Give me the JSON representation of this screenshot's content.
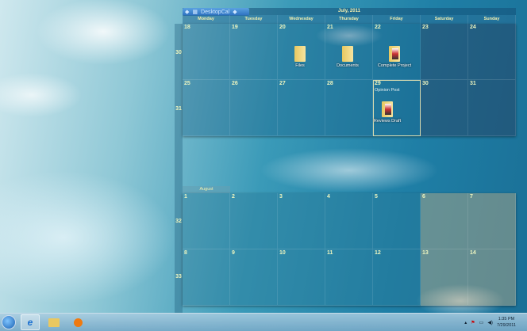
{
  "calendar": {
    "app_name": "DesktopCal",
    "month_title": "July, 2011",
    "days": [
      "Monday",
      "Tuesday",
      "Wednesday",
      "Thursday",
      "Friday",
      "Saturday",
      "Sunday"
    ],
    "july_weeks": [
      {
        "week": "30",
        "dates": [
          "18",
          "19",
          "20",
          "21",
          "22",
          "23",
          "24"
        ]
      },
      {
        "week": "31",
        "dates": [
          "25",
          "26",
          "27",
          "28",
          "29",
          "30",
          "31"
        ]
      }
    ],
    "august_label": "August",
    "august_weeks": [
      {
        "week": "32",
        "dates": [
          "1",
          "2",
          "3",
          "4",
          "5",
          "6",
          "7"
        ]
      },
      {
        "week": "33",
        "dates": [
          "8",
          "9",
          "10",
          "11",
          "12",
          "13",
          "14"
        ]
      }
    ],
    "files": {
      "files": "Files",
      "documents": "Documents",
      "complete_project": "Complete Project",
      "reviews_draft": "Reviews Draft"
    },
    "note_29": "Opinion Post"
  },
  "taskbar": {
    "time": "1:35 PM",
    "date": "7/29/2011",
    "icons": [
      "start-orb",
      "internet-explorer",
      "windows-explorer",
      "media-player"
    ]
  }
}
